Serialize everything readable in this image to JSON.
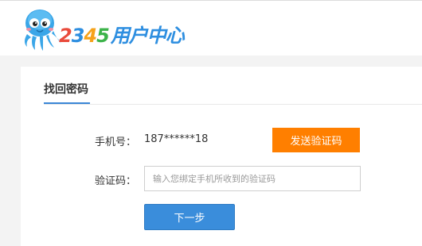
{
  "header": {
    "logo_number": "2345",
    "logo_digits": [
      "2",
      "3",
      "4",
      "5"
    ],
    "logo_digit_colors": [
      "#e94b3c",
      "#2d8ee0",
      "#f6a21a",
      "#3cb34a"
    ],
    "logo_title": "用户中心",
    "logo_title_color": "#2d8ee0"
  },
  "tab": {
    "label": "找回密码",
    "accent_color": "#3a86d6"
  },
  "form": {
    "phone_label": "手机号：",
    "phone_value": "187******18",
    "send_code_button": "发送验证码",
    "code_label": "验证码：",
    "code_placeholder": "输入您绑定手机所收到的验证码",
    "next_button": "下一步"
  },
  "colors": {
    "send_button": "#ff7f00",
    "next_button": "#3a8ddb"
  }
}
